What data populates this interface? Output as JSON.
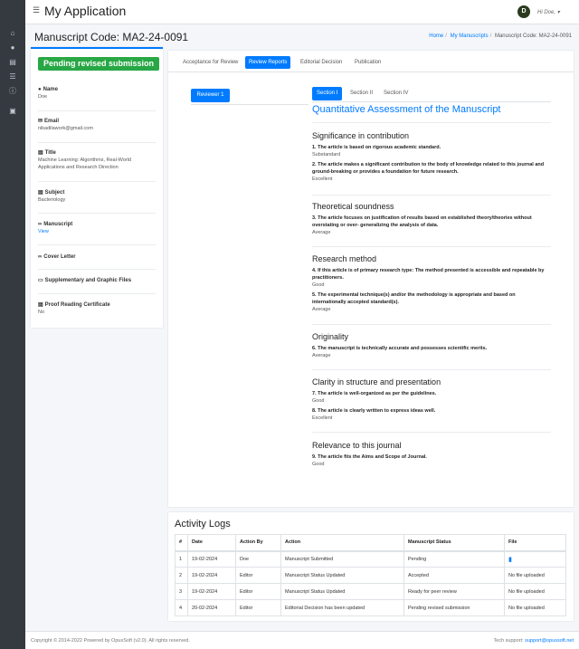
{
  "app": {
    "title": "My Application",
    "user_greeting": "Hi Doe,",
    "user_initial": "D"
  },
  "sidebar": {
    "icons": [
      "home-icon",
      "user-icon",
      "id-card-icon",
      "list-icon",
      "info-icon",
      "document-icon"
    ]
  },
  "page": {
    "title": "Manuscript Code: MA2-24-0091",
    "breadcrumb": {
      "home": "Home",
      "manuscripts": "My Manuscripts",
      "current": "Manuscript Code: MA2-24-0091"
    }
  },
  "details": {
    "status": "Pending revised submission",
    "name_label": "Name",
    "name": "Doe",
    "email_label": "Email",
    "email": "nikadilawork@gmail.com",
    "title_label": "Title",
    "title": "Machine Learning: Algorithms, Real-World Applications and Research Direction",
    "subject_label": "Subject",
    "subject": "Bacteriology",
    "manuscript_label": "Manuscript",
    "manuscript_link": "View",
    "cover_label": "Cover Letter",
    "supp_label": "Supplementary and Graphic Files",
    "proof_label": "Proof Reading Certificate",
    "proof": "No"
  },
  "tabs": [
    "Acceptance for Review",
    "Review Reports",
    "Editorial Decision",
    "Publication"
  ],
  "reviewer_button": "Reviewer 1",
  "sections": [
    "Section I",
    "Section II",
    "Section IV"
  ],
  "qa_title": "Quantitative Assessment of the Manuscript",
  "categories": [
    {
      "title": "Significance in contribution",
      "items": [
        {
          "q": "1. The article is based on rigorous academic standard.",
          "a": "Substandard"
        },
        {
          "q": "2. The article makes a significant contribution to the body of knowledge related to this journal and ground-breaking or provides a foundation for future research.",
          "a": "Excellent"
        }
      ]
    },
    {
      "title": "Theoretical soundness",
      "items": [
        {
          "q": "3. The article focuses on justification of results based on established theory/theories without overstating or over- generalizing the analysis of data.",
          "a": "Average"
        }
      ]
    },
    {
      "title": "Research method",
      "items": [
        {
          "q": "4. If this article is of primary research type: The method presented is accessible and repeatable by practitioners.",
          "a": "Good"
        },
        {
          "q": "5. The experimental technique(s) and/or the methodology is appropriate and based on internationally accepted standard(s).",
          "a": "Average"
        }
      ]
    },
    {
      "title": "Originality",
      "items": [
        {
          "q": "6. The manuscript is technically accurate and possesses scientific merits.",
          "a": "Average"
        }
      ]
    },
    {
      "title": "Clarity in structure and presentation",
      "items": [
        {
          "q": "7. The article is well-organized as per the guidelines.",
          "a": "Good"
        },
        {
          "q": "8. The article is clearly written to express ideas well.",
          "a": "Excellent"
        }
      ]
    },
    {
      "title": "Relevance to this journal",
      "items": [
        {
          "q": "9. The article fits the Aims and Scope of Journal.",
          "a": "Good"
        }
      ]
    }
  ],
  "logs": {
    "title": "Activity Logs",
    "headers": [
      "#",
      "Date",
      "Action By",
      "Action",
      "Manuscript Status",
      "File"
    ],
    "rows": [
      [
        "1",
        "19-02-2024",
        "Doe",
        "Manuscript Submitted",
        "Pending",
        ""
      ],
      [
        "2",
        "19-02-2024",
        "Editor",
        "Manuscript Status Updated",
        "Accepted",
        "No file uploaded"
      ],
      [
        "3",
        "19-02-2024",
        "Editor",
        "Manuscript Status Updated",
        "Ready for peer review",
        "No file uploaded"
      ],
      [
        "4",
        "20-02-2024",
        "Editor",
        "Editorial Decision has been updated",
        "Pending revised submission",
        "No file uploaded"
      ]
    ]
  },
  "footer": {
    "copyright": "Copyright © 2014-2022 Powered by OpusSoft (v2.0). All rights reserved.",
    "support_label": "Tech support:",
    "support_email": "support@opussoft.net"
  }
}
